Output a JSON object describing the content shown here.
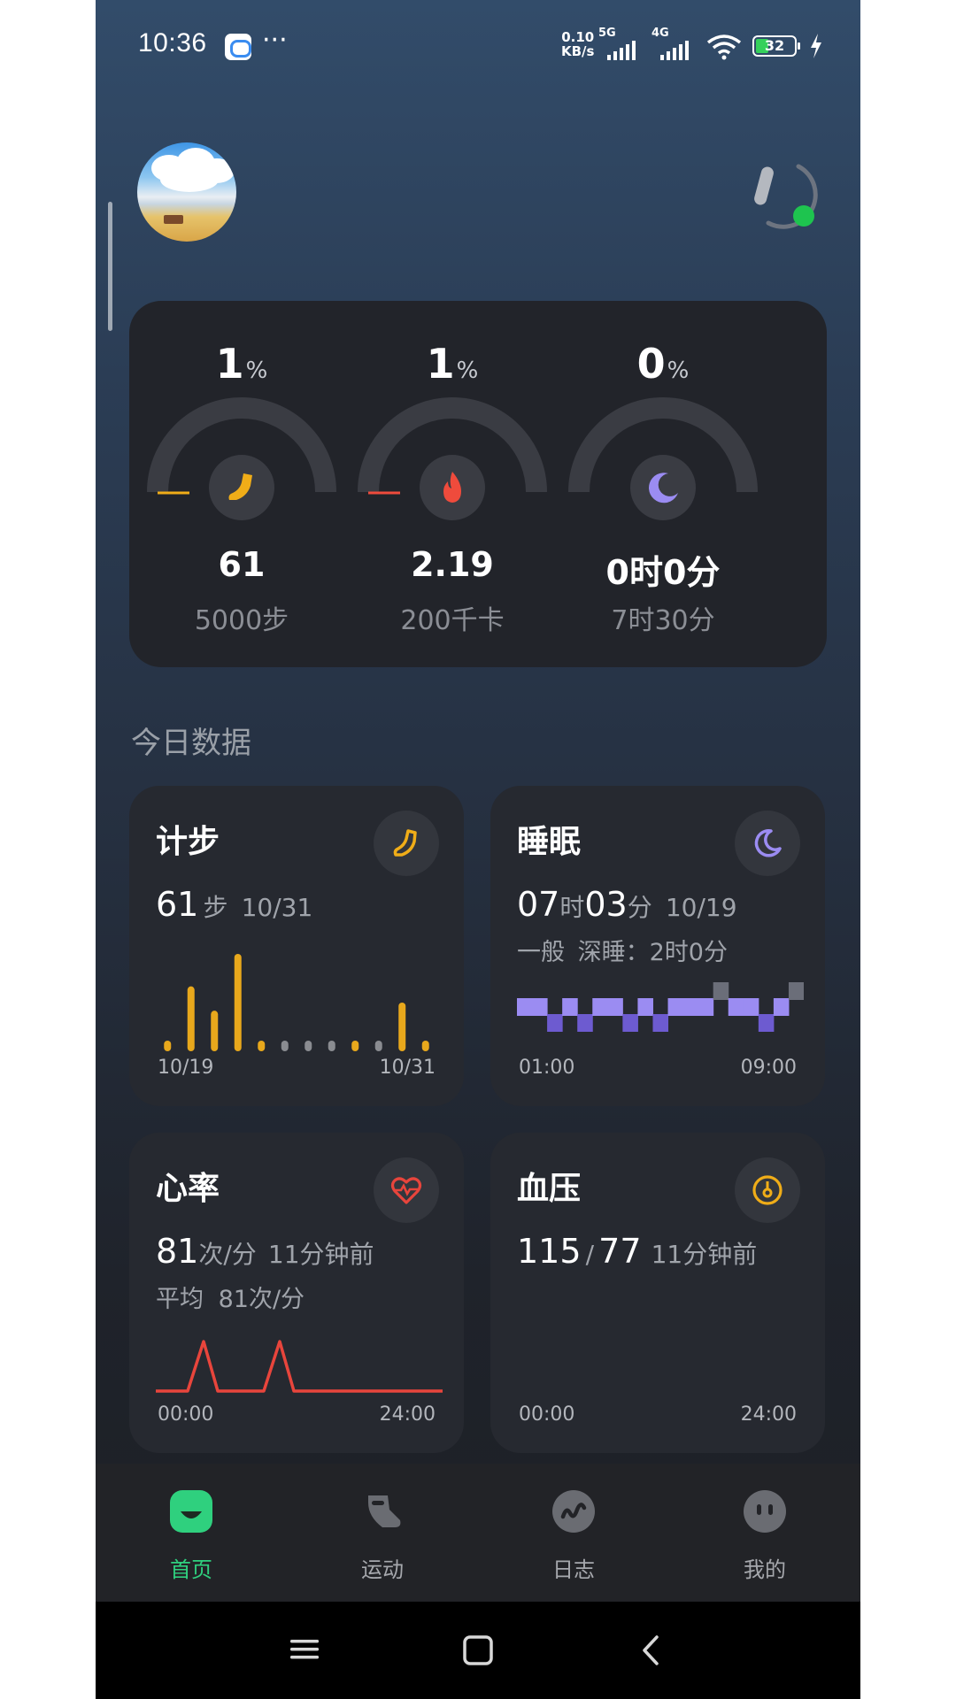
{
  "status_bar": {
    "time": "10:36",
    "more_indicator": "···",
    "net_speed_value": "0.10",
    "net_speed_unit": "KB/s",
    "sim1_label": "5G",
    "sim2_label": "4G",
    "battery": "32",
    "icons": [
      "message-app-icon",
      "signal-icon",
      "wifi-icon",
      "battery-icon",
      "charging-icon"
    ]
  },
  "header": {
    "avatar_icon": "avatar-beach-photo",
    "sync_icon": "device-sync-icon",
    "sync_status_color": "#1ec44f"
  },
  "goals": [
    {
      "key": "steps",
      "percent": "1",
      "percent_unit": "%",
      "progress": 0.01,
      "value": "61",
      "target": "5000步",
      "color": "#f0ad18",
      "icon": "shoe-icon"
    },
    {
      "key": "calories",
      "percent": "1",
      "percent_unit": "%",
      "progress": 0.01,
      "value": "2.19",
      "target": "200千卡",
      "color": "#ef4b3c",
      "icon": "flame-icon"
    },
    {
      "key": "sleep",
      "percent": "0",
      "percent_unit": "%",
      "progress": 0.0,
      "value": "0时0分",
      "target": "7时30分",
      "color": "#9b8cf2",
      "icon": "moon-icon"
    }
  ],
  "section_title": "今日数据",
  "cards": {
    "steps": {
      "title": "计步",
      "icon": "shoe-icon",
      "value": "61",
      "unit": "步",
      "date": "10/31",
      "axis_start": "10/19",
      "axis_end": "10/31",
      "bar_values": [
        6,
        40,
        25,
        60,
        6,
        6,
        6,
        6,
        6,
        6,
        30,
        6
      ],
      "bar_colors": [
        "#e8a81c",
        "#e8a81c",
        "#e8a81c",
        "#e8a81c",
        "#e8a81c",
        "#8a8c91",
        "#8a8c91",
        "#8a8c91",
        "#e8a81c",
        "#8a8c91",
        "#e8a81c",
        "#e8a81c"
      ]
    },
    "sleep": {
      "title": "睡眠",
      "icon": "moon-icon",
      "hours": "07",
      "hours_unit": "时",
      "minutes": "03",
      "minutes_unit": "分",
      "date": "10/19",
      "quality": "一般",
      "deep_label": "深睡：",
      "deep_value": "2时0分",
      "axis_start": "01:00",
      "axis_end": "09:00",
      "stages": [
        "light",
        "light",
        "deep",
        "light",
        "deep",
        "light",
        "light",
        "deep",
        "light",
        "deep",
        "light",
        "light",
        "light",
        "awake",
        "light",
        "light",
        "deep",
        "light",
        "awake"
      ]
    },
    "heart": {
      "title": "心率",
      "icon": "heart-rate-icon",
      "value": "81",
      "unit": "次/分",
      "ago": "11分钟前",
      "avg_label": "平均",
      "avg_value": "81次/分",
      "axis_start": "00:00",
      "axis_end": "24:00",
      "color": "#e8453c"
    },
    "bp": {
      "title": "血压",
      "icon": "blood-pressure-icon",
      "systolic": "115",
      "separator": "/",
      "diastolic": "77",
      "ago": "11分钟前",
      "axis_start": "00:00",
      "axis_end": "24:00"
    }
  },
  "nav": [
    {
      "label": "首页",
      "icon": "home-icon",
      "active": true
    },
    {
      "label": "运动",
      "icon": "sport-shoe-icon",
      "active": false
    },
    {
      "label": "日志",
      "icon": "log-icon",
      "active": false
    },
    {
      "label": "我的",
      "icon": "profile-icon",
      "active": false
    }
  ],
  "system_nav": [
    "menu-icon",
    "home-square-icon",
    "back-icon"
  ]
}
